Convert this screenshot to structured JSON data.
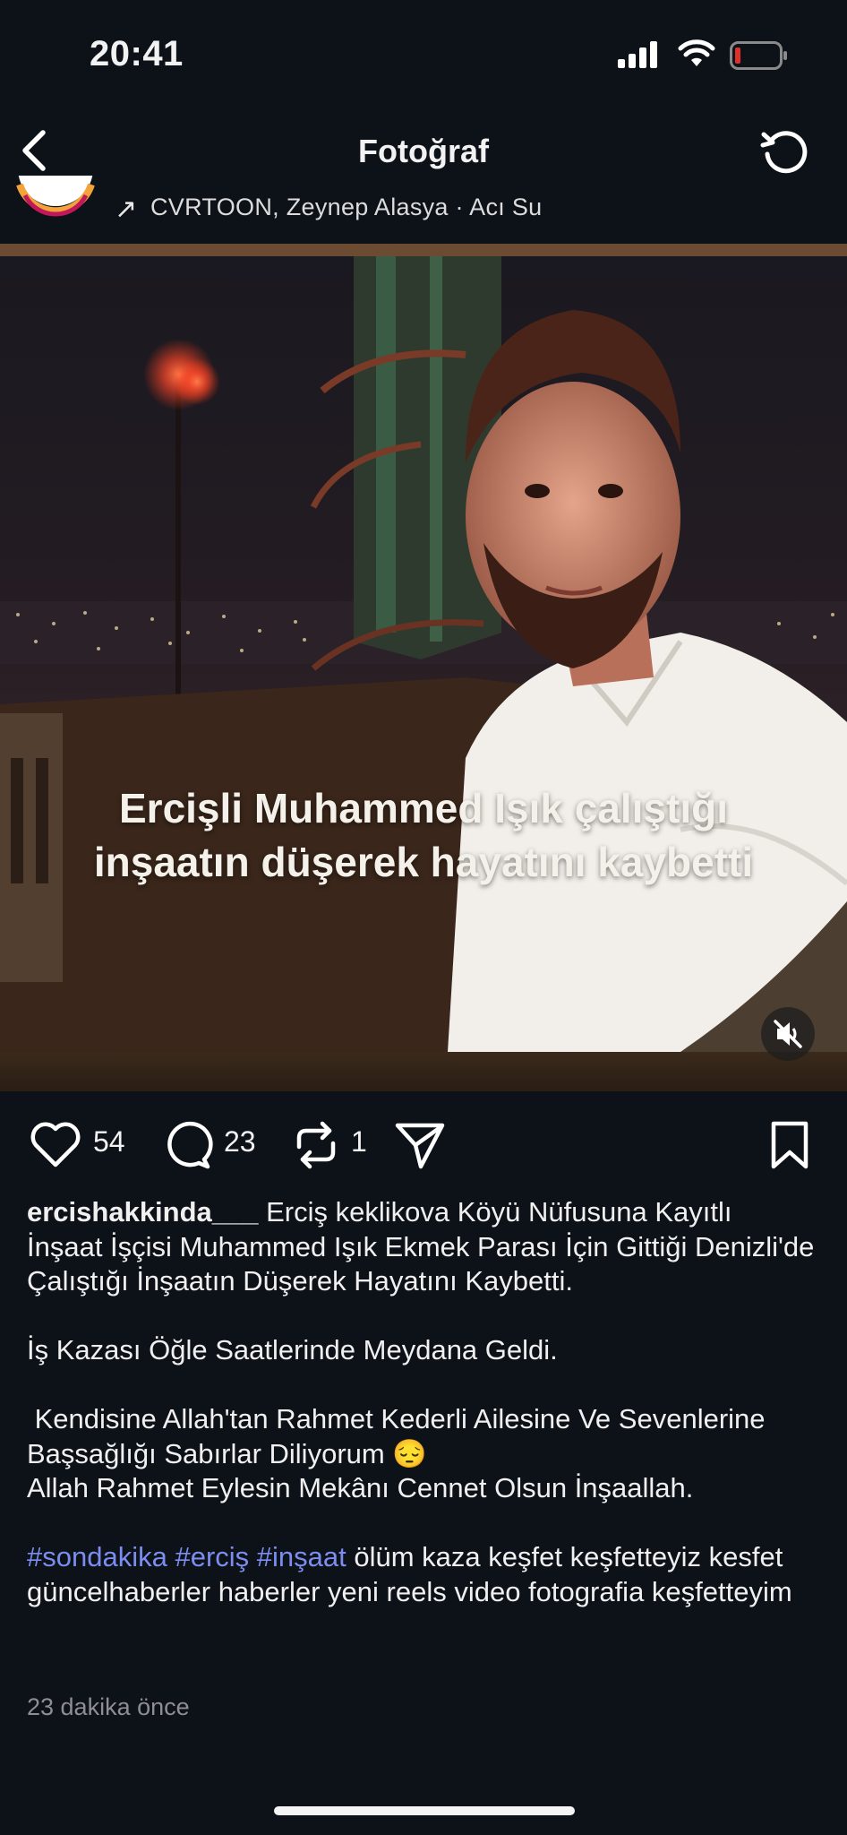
{
  "status_bar": {
    "time": "20:41",
    "battery_color": "#e0302a"
  },
  "nav": {
    "title": "Fotoğraf"
  },
  "audio": {
    "label": "CVRTOON, Zeynep Alasya · Acı Su"
  },
  "media": {
    "overlay_text": "Ercişli Muhammed Işık çalıştığı inşaatın düşerek hayatını kaybetti",
    "muted": true
  },
  "actions": {
    "likes": "54",
    "comments": "23",
    "reposts": "1"
  },
  "post": {
    "username": "ercishakkinda___",
    "caption_lines": [
      " Erciş keklikova Köyü Nüfusuna Kayıtlı İnşaat İşçisi Muhammed Işık Ekmek Parası İçin Gittiği Denizli'de  Çalıştığı İnşaatın Düşerek Hayatını Kaybetti.",
      "İş Kazası Öğle Saatlerinde Meydana Geldi.",
      " Kendisine Allah'tan Rahmet Kederli Ailesine Ve Sevenlerine Başsağlığı Sabırlar Diliyorum 😔\nAllah Rahmet Eylesin Mekânı Cennet Olsun İnşaallah."
    ],
    "hashtags": [
      "#sondakika",
      "#erciş",
      "#inşaat"
    ],
    "keywords": " ölüm kaza keşfet keşfetteyiz kesfet güncelhaberler haberler yeni reels video fotografia keşfetteyim",
    "timestamp": "23 dakika önce"
  },
  "colors": {
    "background": "#0d1118",
    "hashtag": "#7b8ef0",
    "muted_text": "#8e8e94"
  }
}
